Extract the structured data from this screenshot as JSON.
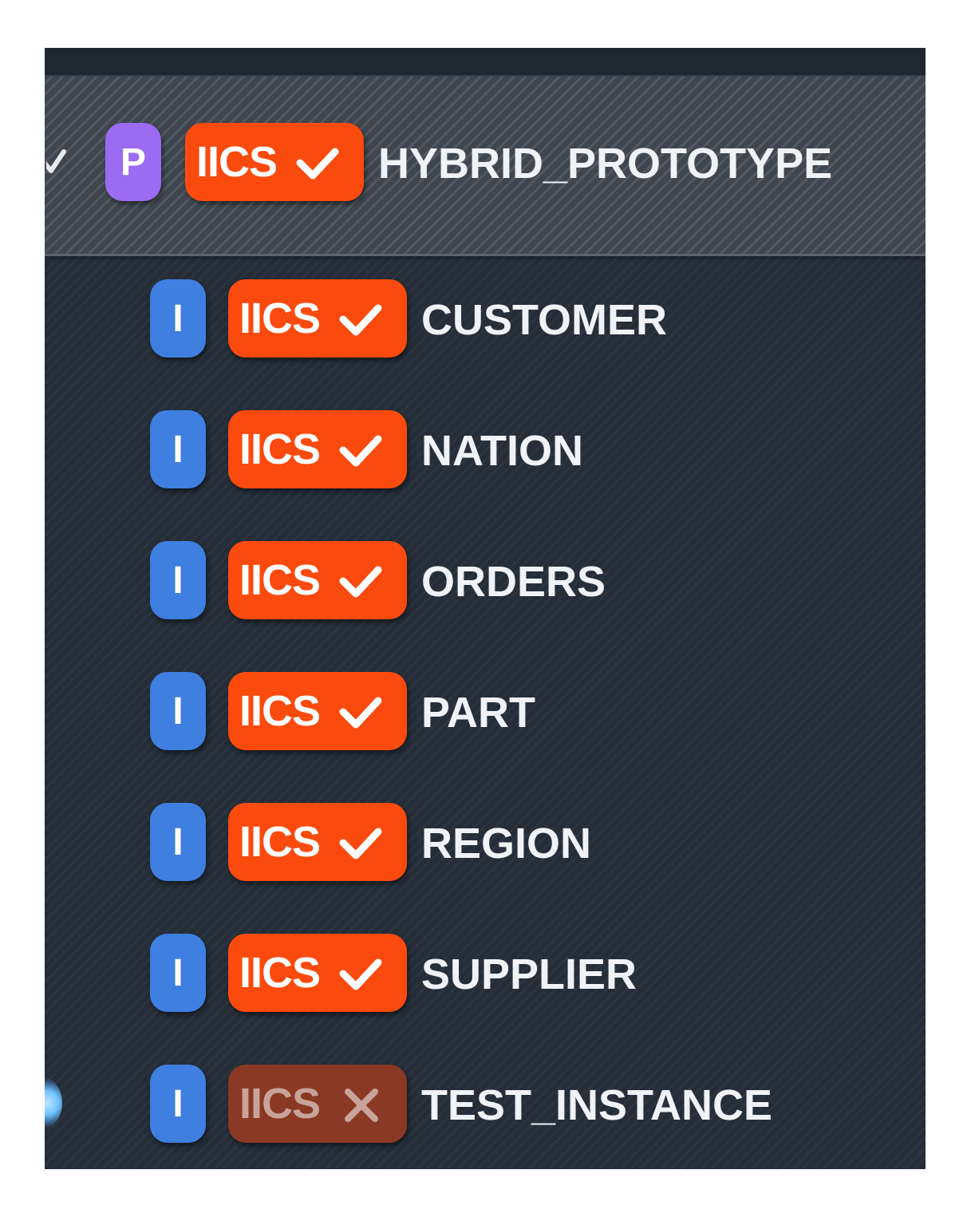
{
  "tree": {
    "parent": {
      "type_letter": "P",
      "connector_label": "IICS",
      "connector_status": "ok",
      "name": "HYBRID_PROTOTYPE"
    },
    "children": [
      {
        "type_letter": "I",
        "connector_label": "IICS",
        "connector_status": "ok",
        "name": "CUSTOMER"
      },
      {
        "type_letter": "I",
        "connector_label": "IICS",
        "connector_status": "ok",
        "name": "NATION"
      },
      {
        "type_letter": "I",
        "connector_label": "IICS",
        "connector_status": "ok",
        "name": "ORDERS"
      },
      {
        "type_letter": "I",
        "connector_label": "IICS",
        "connector_status": "ok",
        "name": "PART"
      },
      {
        "type_letter": "I",
        "connector_label": "IICS",
        "connector_status": "ok",
        "name": "REGION"
      },
      {
        "type_letter": "I",
        "connector_label": "IICS",
        "connector_status": "ok",
        "name": "SUPPLIER"
      },
      {
        "type_letter": "I",
        "connector_label": "IICS",
        "connector_status": "error",
        "name": "TEST_INSTANCE"
      }
    ]
  },
  "colors": {
    "panel_bg": "#242d38",
    "parent_type_badge": "#9b6cf2",
    "child_type_badge": "#3f7fe0",
    "iics_ok": "#fb4a0e",
    "iics_error": "#8a3a24",
    "text": "#f0f2f5"
  },
  "icons": {
    "expand": "chevron-down-icon",
    "ok": "checkmark-icon",
    "error": "cross-icon",
    "selected_indicator": "glow-dot-icon"
  }
}
